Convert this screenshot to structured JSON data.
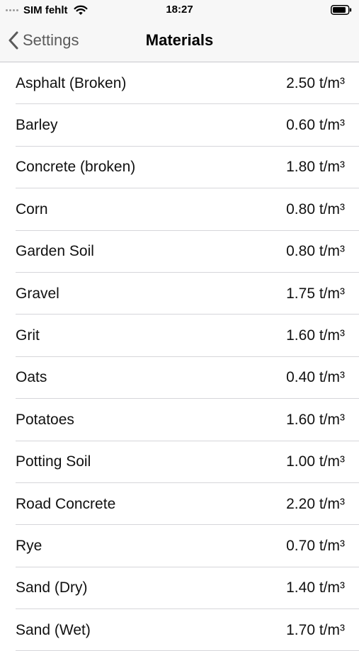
{
  "status": {
    "carrier": "SIM fehlt",
    "time": "18:27"
  },
  "nav": {
    "back_label": "Settings",
    "title": "Materials"
  },
  "materials": [
    {
      "name": "Asphalt (Broken)",
      "density": "2.50 t/m³"
    },
    {
      "name": "Barley",
      "density": "0.60 t/m³"
    },
    {
      "name": "Concrete (broken)",
      "density": "1.80 t/m³"
    },
    {
      "name": "Corn",
      "density": "0.80 t/m³"
    },
    {
      "name": "Garden Soil",
      "density": "0.80 t/m³"
    },
    {
      "name": "Gravel",
      "density": "1.75 t/m³"
    },
    {
      "name": "Grit",
      "density": "1.60 t/m³"
    },
    {
      "name": "Oats",
      "density": "0.40 t/m³"
    },
    {
      "name": "Potatoes",
      "density": "1.60 t/m³"
    },
    {
      "name": "Potting Soil",
      "density": "1.00 t/m³"
    },
    {
      "name": "Road Concrete",
      "density": "2.20 t/m³"
    },
    {
      "name": "Rye",
      "density": "0.70 t/m³"
    },
    {
      "name": "Sand (Dry)",
      "density": "1.40 t/m³"
    },
    {
      "name": "Sand (Wet)",
      "density": "1.70 t/m³"
    }
  ],
  "icons": {
    "signal": "signal-dots-icon",
    "wifi": "wifi-icon",
    "battery": "battery-icon",
    "back": "chevron-left-icon"
  }
}
